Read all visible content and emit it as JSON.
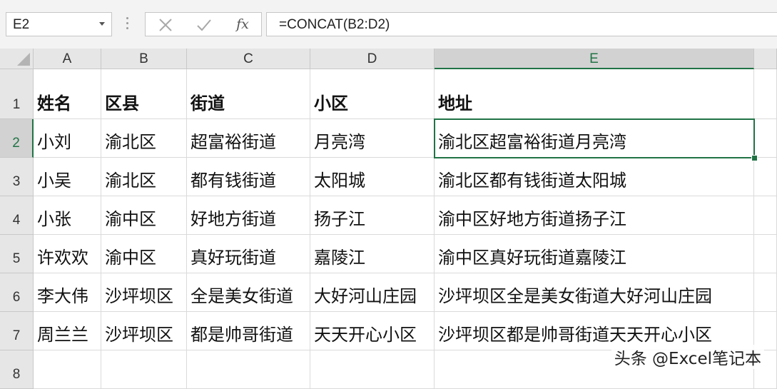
{
  "formula_bar": {
    "name_box": "E2",
    "cancel_icon": "close-icon",
    "enter_icon": "checkmark-icon",
    "fx_label": "fx",
    "formula": "=CONCAT(B2:D2)"
  },
  "grid": {
    "columns": [
      "A",
      "B",
      "C",
      "D",
      "E"
    ],
    "rows": [
      "1",
      "2",
      "3",
      "4",
      "5",
      "6",
      "7",
      "8"
    ],
    "selected_cell": "E2",
    "cells": [
      [
        "姓名",
        "区县",
        "街道",
        "小区",
        "地址"
      ],
      [
        "小刘",
        "渝北区",
        "超富裕街道",
        "月亮湾",
        "渝北区超富裕街道月亮湾"
      ],
      [
        "小吴",
        "渝北区",
        "都有钱街道",
        "太阳城",
        "渝北区都有钱街道太阳城"
      ],
      [
        "小张",
        "渝中区",
        "好地方街道",
        "扬子江",
        "渝中区好地方街道扬子江"
      ],
      [
        "许欢欢",
        "渝中区",
        "真好玩街道",
        "嘉陵江",
        "渝中区真好玩街道嘉陵江"
      ],
      [
        "李大伟",
        "沙坪坝区",
        "全是美女街道",
        "大好河山庄园",
        "沙坪坝区全是美女街道大好河山庄园"
      ],
      [
        "周兰兰",
        "沙坪坝区",
        "都是帅哥街道",
        "天天开心小区",
        "沙坪坝区都是帅哥街道天天开心小区"
      ],
      [
        "",
        "",
        "",
        "",
        ""
      ]
    ]
  },
  "colors": {
    "accent": "#217346",
    "header_bg": "#e6e6e6",
    "gridline": "#dadada"
  },
  "watermark": "头条 @Excel笔记本"
}
